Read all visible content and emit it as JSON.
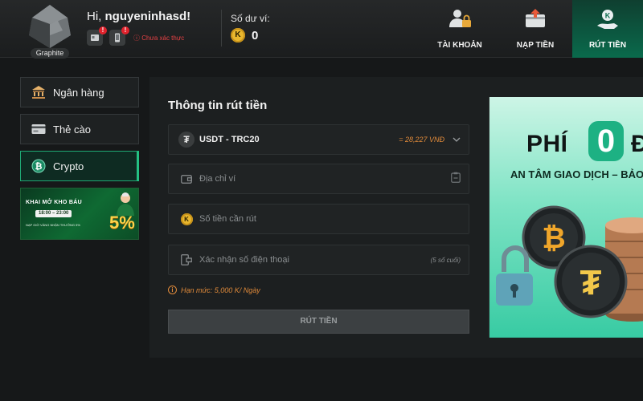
{
  "header": {
    "rank_label": "Graphite",
    "greeting_prefix": "Hi, ",
    "username": "nguyeninhasd!",
    "unverified_text": "Chưa xác thực",
    "badge_mark": "!",
    "balance_label": "Số dư ví:",
    "coin_symbol": "K",
    "balance_value": "0",
    "nav": [
      {
        "label": "TÀI KHOẢN",
        "icon": "account-lock-icon",
        "active": false
      },
      {
        "label": "NẠP TIỀN",
        "icon": "deposit-icon",
        "active": false
      },
      {
        "label": "RÚT TIỀN",
        "icon": "withdraw-icon",
        "active": true
      }
    ]
  },
  "sidebar": {
    "items": [
      {
        "label": "Ngân hàng",
        "icon": "bank-icon",
        "active": false
      },
      {
        "label": "Thẻ cào",
        "icon": "card-icon",
        "active": false
      },
      {
        "label": "Crypto",
        "icon": "crypto-icon",
        "active": true
      }
    ],
    "promo": {
      "title": "KHAI MỞ KHO BÁU",
      "time": "18:00 – 23:00",
      "subtitle": "NẠP GIỜ VÀNG NHẬN THƯỞNG 5%",
      "percent": "5%"
    }
  },
  "form": {
    "title": "Thông tin rút tiền",
    "currency_label": "USDT - TRC20",
    "currency_symbol": "₮",
    "rate": "= 28,227 VNĐ",
    "wallet_placeholder": "Địa chỉ ví",
    "amount_placeholder": "Số tiền cần rút",
    "amount_coin": "K",
    "phone_placeholder": "Xác nhận số điện thoại",
    "phone_suffix": "(5 số cuối)",
    "limit_mark": "i",
    "limit_text": "Hạn mức: 5,000 K/ Ngày",
    "submit_label": "RÚT TIỀN"
  },
  "banner": {
    "headline_left": "PHÍ",
    "headline_zero": "0",
    "headline_right": "Đ",
    "subline": "AN TÂM GIAO DỊCH – BẢO"
  },
  "colors": {
    "accent": "#1fa874",
    "warning": "#e08a3a",
    "error": "#e84245",
    "coin": "#e9b72e"
  }
}
